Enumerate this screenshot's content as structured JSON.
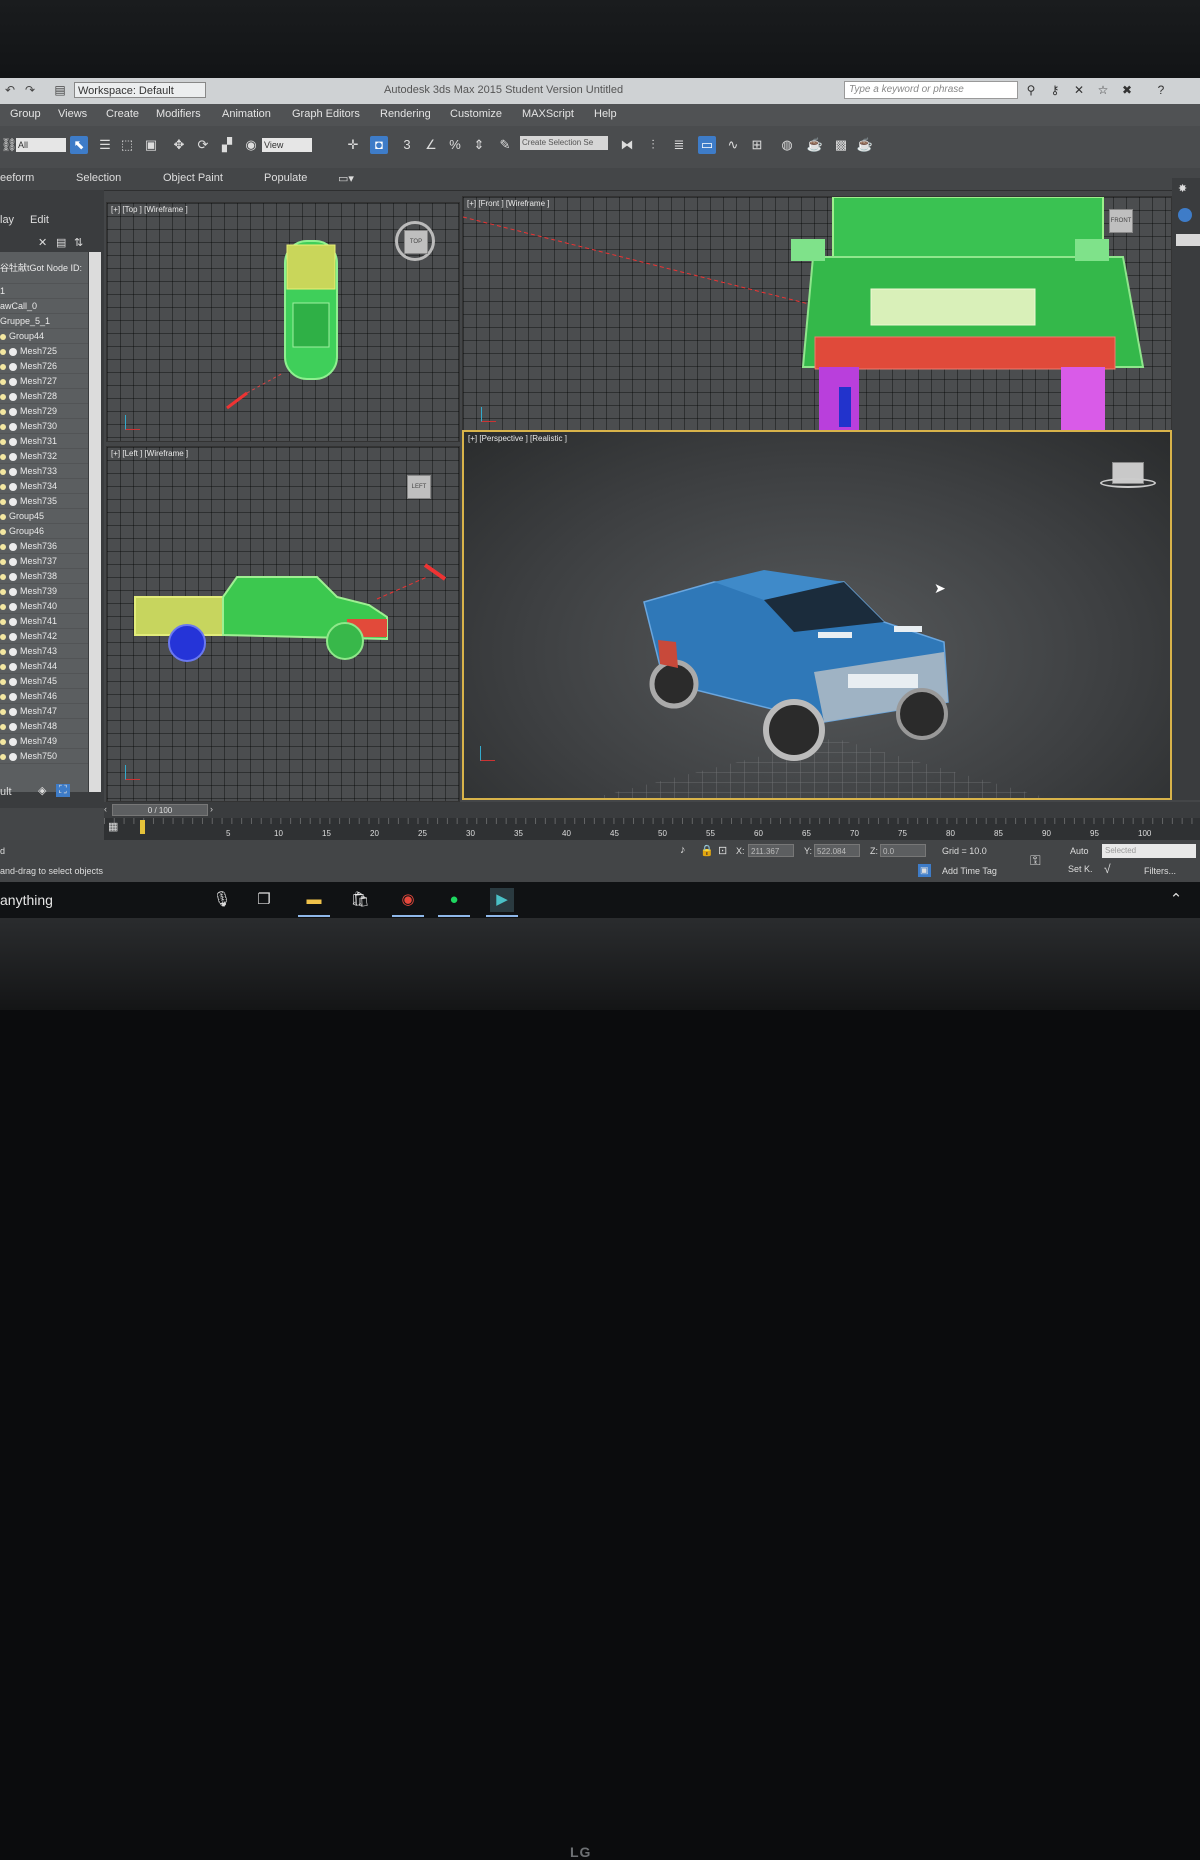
{
  "title_bar": {
    "workspace": "Workspace: Default",
    "app_title": "Autodesk 3ds Max  2015    Student Version    Untitled",
    "search_placeholder": "Type a keyword or phrase"
  },
  "menu": [
    "Group",
    "Views",
    "Create",
    "Modifiers",
    "Animation",
    "Graph Editors",
    "Rendering",
    "Customize",
    "MAXScript",
    "Help"
  ],
  "toolbar": {
    "selection_filter": "All",
    "view_dropdown": "View",
    "named_selection": "Create Selection Se"
  },
  "ribbon": [
    "eeform",
    "Selection",
    "Object Paint",
    "Populate"
  ],
  "left_panel": {
    "tabs": [
      "lay",
      "Edit"
    ],
    "header_text": "谷牡献tGot Node ID:",
    "tree": [
      {
        "label": "1",
        "kind": "plain"
      },
      {
        "label": "awCall_0",
        "kind": "plain"
      },
      {
        "label": "Gruppe_5_1",
        "kind": "plain"
      },
      {
        "label": "Group44",
        "kind": "group"
      },
      {
        "label": "Mesh725",
        "kind": "mesh"
      },
      {
        "label": "Mesh726",
        "kind": "mesh"
      },
      {
        "label": "Mesh727",
        "kind": "mesh"
      },
      {
        "label": "Mesh728",
        "kind": "mesh"
      },
      {
        "label": "Mesh729",
        "kind": "mesh"
      },
      {
        "label": "Mesh730",
        "kind": "mesh"
      },
      {
        "label": "Mesh731",
        "kind": "mesh"
      },
      {
        "label": "Mesh732",
        "kind": "mesh"
      },
      {
        "label": "Mesh733",
        "kind": "mesh"
      },
      {
        "label": "Mesh734",
        "kind": "mesh"
      },
      {
        "label": "Mesh735",
        "kind": "mesh"
      },
      {
        "label": "Group45",
        "kind": "group"
      },
      {
        "label": "Group46",
        "kind": "group"
      },
      {
        "label": "Mesh736",
        "kind": "mesh"
      },
      {
        "label": "Mesh737",
        "kind": "mesh"
      },
      {
        "label": "Mesh738",
        "kind": "mesh"
      },
      {
        "label": "Mesh739",
        "kind": "mesh"
      },
      {
        "label": "Mesh740",
        "kind": "mesh"
      },
      {
        "label": "Mesh741",
        "kind": "mesh"
      },
      {
        "label": "Mesh742",
        "kind": "mesh"
      },
      {
        "label": "Mesh743",
        "kind": "mesh"
      },
      {
        "label": "Mesh744",
        "kind": "mesh"
      },
      {
        "label": "Mesh745",
        "kind": "mesh"
      },
      {
        "label": "Mesh746",
        "kind": "mesh"
      },
      {
        "label": "Mesh747",
        "kind": "mesh"
      },
      {
        "label": "Mesh748",
        "kind": "mesh"
      },
      {
        "label": "Mesh749",
        "kind": "mesh"
      },
      {
        "label": "Mesh750",
        "kind": "mesh"
      }
    ],
    "footer": "ult"
  },
  "viewports": {
    "top": "[+] [Top ] [Wireframe ]",
    "front": "[+] [Front ] [Wireframe ]",
    "left": "[+] [Left ] [Wireframe ]",
    "perspective": "[+] [Perspective ] [Realistic ]",
    "cube_labels": {
      "top": "TOP",
      "front": "FRONT",
      "left": "LEFT"
    }
  },
  "timeline": {
    "slider": "0 / 100",
    "ticks": [
      "5",
      "10",
      "15",
      "20",
      "25",
      "30",
      "35",
      "40",
      "45",
      "50",
      "55",
      "60",
      "65",
      "70",
      "75",
      "80",
      "85",
      "90",
      "95",
      "100"
    ]
  },
  "status": {
    "line1": "d",
    "prompt": "and-drag to select objects",
    "x_label": "X:",
    "x_value": "211.367",
    "y_label": "Y:",
    "y_value": "522.084",
    "z_label": "Z:",
    "z_value": "0.0",
    "grid": "Grid = 10.0",
    "add_time_tag": "Add Time Tag",
    "auto": "Auto",
    "set_key": "Set K.",
    "selected": "Selected",
    "filters": "Filters..."
  },
  "taskbar": {
    "search": "anything",
    "apps": [
      "mic-icon",
      "task-view-icon",
      "file-explorer-icon",
      "store-icon",
      "chrome-icon",
      "spotify-icon",
      "3dsmax-icon"
    ]
  },
  "monitor_brand": "LG",
  "colors": {
    "accent_active": "#3e7cc8",
    "viewport_border_active": "#d8b34a",
    "truck_blue": "#2f78b8"
  }
}
